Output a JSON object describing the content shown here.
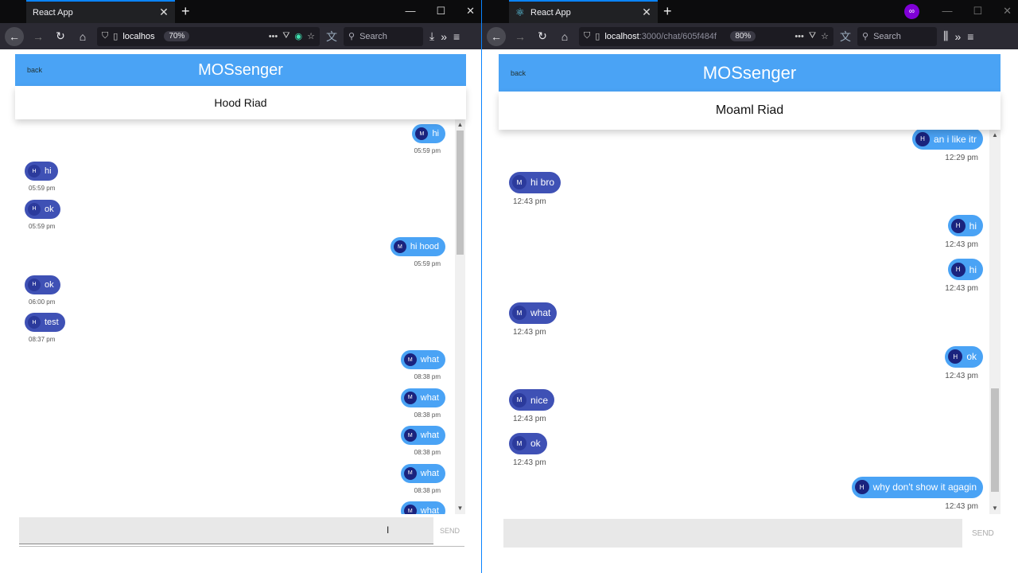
{
  "left": {
    "tab_title": "React App",
    "url": "localhos",
    "zoom": "70%",
    "search_placeholder": "Search",
    "app_title": "MOSsenger",
    "back_label": "back",
    "contact_name": "Hood Riad",
    "send_label": "SEND",
    "messages": [
      {
        "side": "own",
        "avatar": "M",
        "text": "hi",
        "time": "05:59 pm"
      },
      {
        "side": "other",
        "avatar": "H",
        "text": "hi",
        "time": "05:59 pm"
      },
      {
        "side": "other",
        "avatar": "H",
        "text": "ok",
        "time": "05:59 pm"
      },
      {
        "side": "own",
        "avatar": "M",
        "text": "hi hood",
        "time": "05:59 pm"
      },
      {
        "side": "other",
        "avatar": "H",
        "text": "ok",
        "time": "06:00 pm"
      },
      {
        "side": "other",
        "avatar": "H",
        "text": "test",
        "time": "08:37 pm"
      },
      {
        "side": "own",
        "avatar": "M",
        "text": "what",
        "time": "08:38 pm"
      },
      {
        "side": "own",
        "avatar": "M",
        "text": "what",
        "time": "08:38 pm"
      },
      {
        "side": "own",
        "avatar": "M",
        "text": "what",
        "time": "08:38 pm"
      },
      {
        "side": "own",
        "avatar": "M",
        "text": "what",
        "time": "08:38 pm"
      },
      {
        "side": "own",
        "avatar": "M",
        "text": "what",
        "time": ""
      }
    ]
  },
  "right": {
    "tab_title": "React App",
    "url": "localhost",
    "url_path": ":3000/chat/605f484f",
    "zoom": "80%",
    "search_placeholder": "Search",
    "app_title": "MOSsenger",
    "back_label": "back",
    "contact_name": "Moaml Riad",
    "send_label": "SEND",
    "messages": [
      {
        "side": "own",
        "avatar": "H",
        "text": "an i like itr",
        "time": "12:29 pm"
      },
      {
        "side": "other",
        "avatar": "M",
        "text": "hi bro",
        "time": "12:43 pm"
      },
      {
        "side": "own",
        "avatar": "H",
        "text": "hi",
        "time": "12:43 pm"
      },
      {
        "side": "own",
        "avatar": "H",
        "text": "hi",
        "time": "12:43 pm"
      },
      {
        "side": "other",
        "avatar": "M",
        "text": "what",
        "time": "12:43 pm"
      },
      {
        "side": "own",
        "avatar": "H",
        "text": "ok",
        "time": "12:43 pm"
      },
      {
        "side": "other",
        "avatar": "M",
        "text": "nice",
        "time": "12:43 pm"
      },
      {
        "side": "other",
        "avatar": "M",
        "text": "ok",
        "time": "12:43 pm"
      },
      {
        "side": "own",
        "avatar": "H",
        "text": "why don't show it agagin",
        "time": "12:43 pm"
      }
    ]
  },
  "colors": {
    "header_blue": "#4aa3f5",
    "own_bubble": "#4aa3f5",
    "other_bubble": "#3f51b5",
    "tab_accent": "#0a84ff"
  }
}
